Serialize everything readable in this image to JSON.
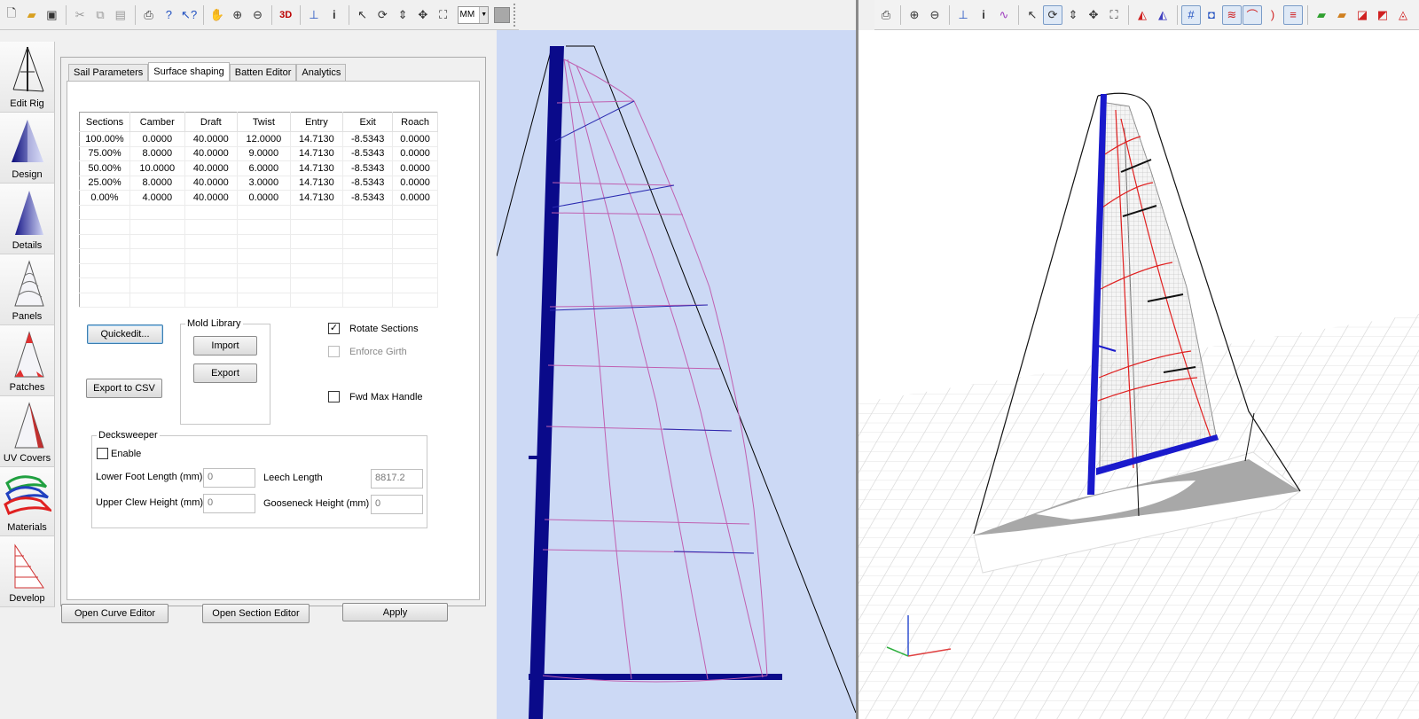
{
  "toolbar_left": {
    "view_3d_label": "3D",
    "units_value": "MM"
  },
  "sidebar": {
    "items": [
      {
        "label": "Edit Rig"
      },
      {
        "label": "Design"
      },
      {
        "label": "Details"
      },
      {
        "label": "Panels"
      },
      {
        "label": "Patches"
      },
      {
        "label": "UV Covers"
      },
      {
        "label": "Materials"
      },
      {
        "label": "Develop"
      }
    ]
  },
  "tabs": [
    {
      "label": "Sail Parameters"
    },
    {
      "label": "Surface shaping"
    },
    {
      "label": "Batten Editor"
    },
    {
      "label": "Analytics"
    }
  ],
  "sections_table": {
    "headers": [
      "Sections",
      "Camber",
      "Draft",
      "Twist",
      "Entry",
      "Exit",
      "Roach"
    ],
    "rows": [
      [
        "100.00%",
        "0.0000",
        "40.0000",
        "12.0000",
        "14.7130",
        "-8.5343",
        "0.0000"
      ],
      [
        "75.00%",
        "8.0000",
        "40.0000",
        "9.0000",
        "14.7130",
        "-8.5343",
        "0.0000"
      ],
      [
        "50.00%",
        "10.0000",
        "40.0000",
        "6.0000",
        "14.7130",
        "-8.5343",
        "0.0000"
      ],
      [
        "25.00%",
        "8.0000",
        "40.0000",
        "3.0000",
        "14.7130",
        "-8.5343",
        "0.0000"
      ],
      [
        "0.00%",
        "4.0000",
        "40.0000",
        "0.0000",
        "14.7130",
        "-8.5343",
        "0.0000"
      ]
    ]
  },
  "controls": {
    "quickedit_label": "Quickedit...",
    "export_csv_label": "Export to CSV",
    "mold_library_label": "Mold Library",
    "import_label": "Import",
    "export_label": "Export",
    "rotate_sections_label": "Rotate Sections",
    "rotate_sections_checked": true,
    "enforce_girth_label": "Enforce Girth",
    "enforce_girth_enabled": false,
    "fwd_max_handle_label": "Fwd Max Handle",
    "fwd_max_handle_checked": false
  },
  "decksweeper": {
    "title": "Decksweeper",
    "enable_label": "Enable",
    "lower_foot_label": "Lower Foot Length (mm)",
    "lower_foot_value": "0",
    "leech_length_label": "Leech Length",
    "leech_length_value": "8817.2",
    "upper_clew_label": "Upper Clew Height (mm)",
    "upper_clew_value": "0",
    "gooseneck_label": "Gooseneck Height (mm)",
    "gooseneck_value": "0"
  },
  "bottom_buttons": {
    "curve_editor_label": "Open Curve Editor",
    "section_editor_label": "Open Section Editor",
    "apply_label": "Apply"
  },
  "colors": {
    "mast_blue": "#0a0a8a",
    "sail_line_pink": "#c060b0",
    "batten_red": "#e02020",
    "view2d_background": "#ccd9f5"
  }
}
